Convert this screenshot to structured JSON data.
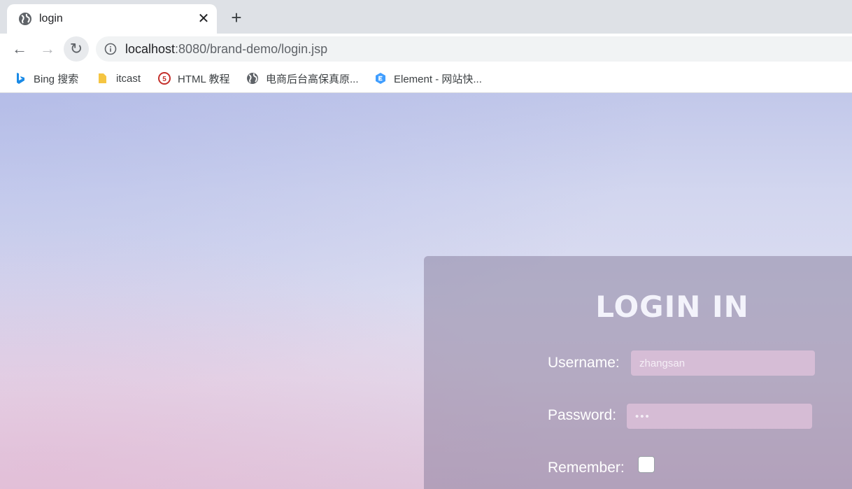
{
  "tab": {
    "title": "login",
    "close": "✕",
    "new_tab": "+"
  },
  "toolbar": {
    "back": "←",
    "forward": "→",
    "reload": "↻",
    "url_host": "localhost",
    "url_rest": ":8080/brand-demo/login.jsp"
  },
  "bookmarks": [
    {
      "label": "Bing 搜索",
      "icon": "bing-icon"
    },
    {
      "label": "itcast",
      "icon": "folder-icon"
    },
    {
      "label": "HTML 教程",
      "icon": "html5-icon"
    },
    {
      "label": "电商后台高保真原...",
      "icon": "globe-icon"
    },
    {
      "label": "Element - 网站快...",
      "icon": "element-icon"
    }
  ],
  "login": {
    "title": "LOGIN IN",
    "username_label": "Username:",
    "username_value": "zhangsan",
    "password_label": "Password:",
    "password_value": "•••",
    "remember_label": "Remember:",
    "remember_checked": false
  }
}
